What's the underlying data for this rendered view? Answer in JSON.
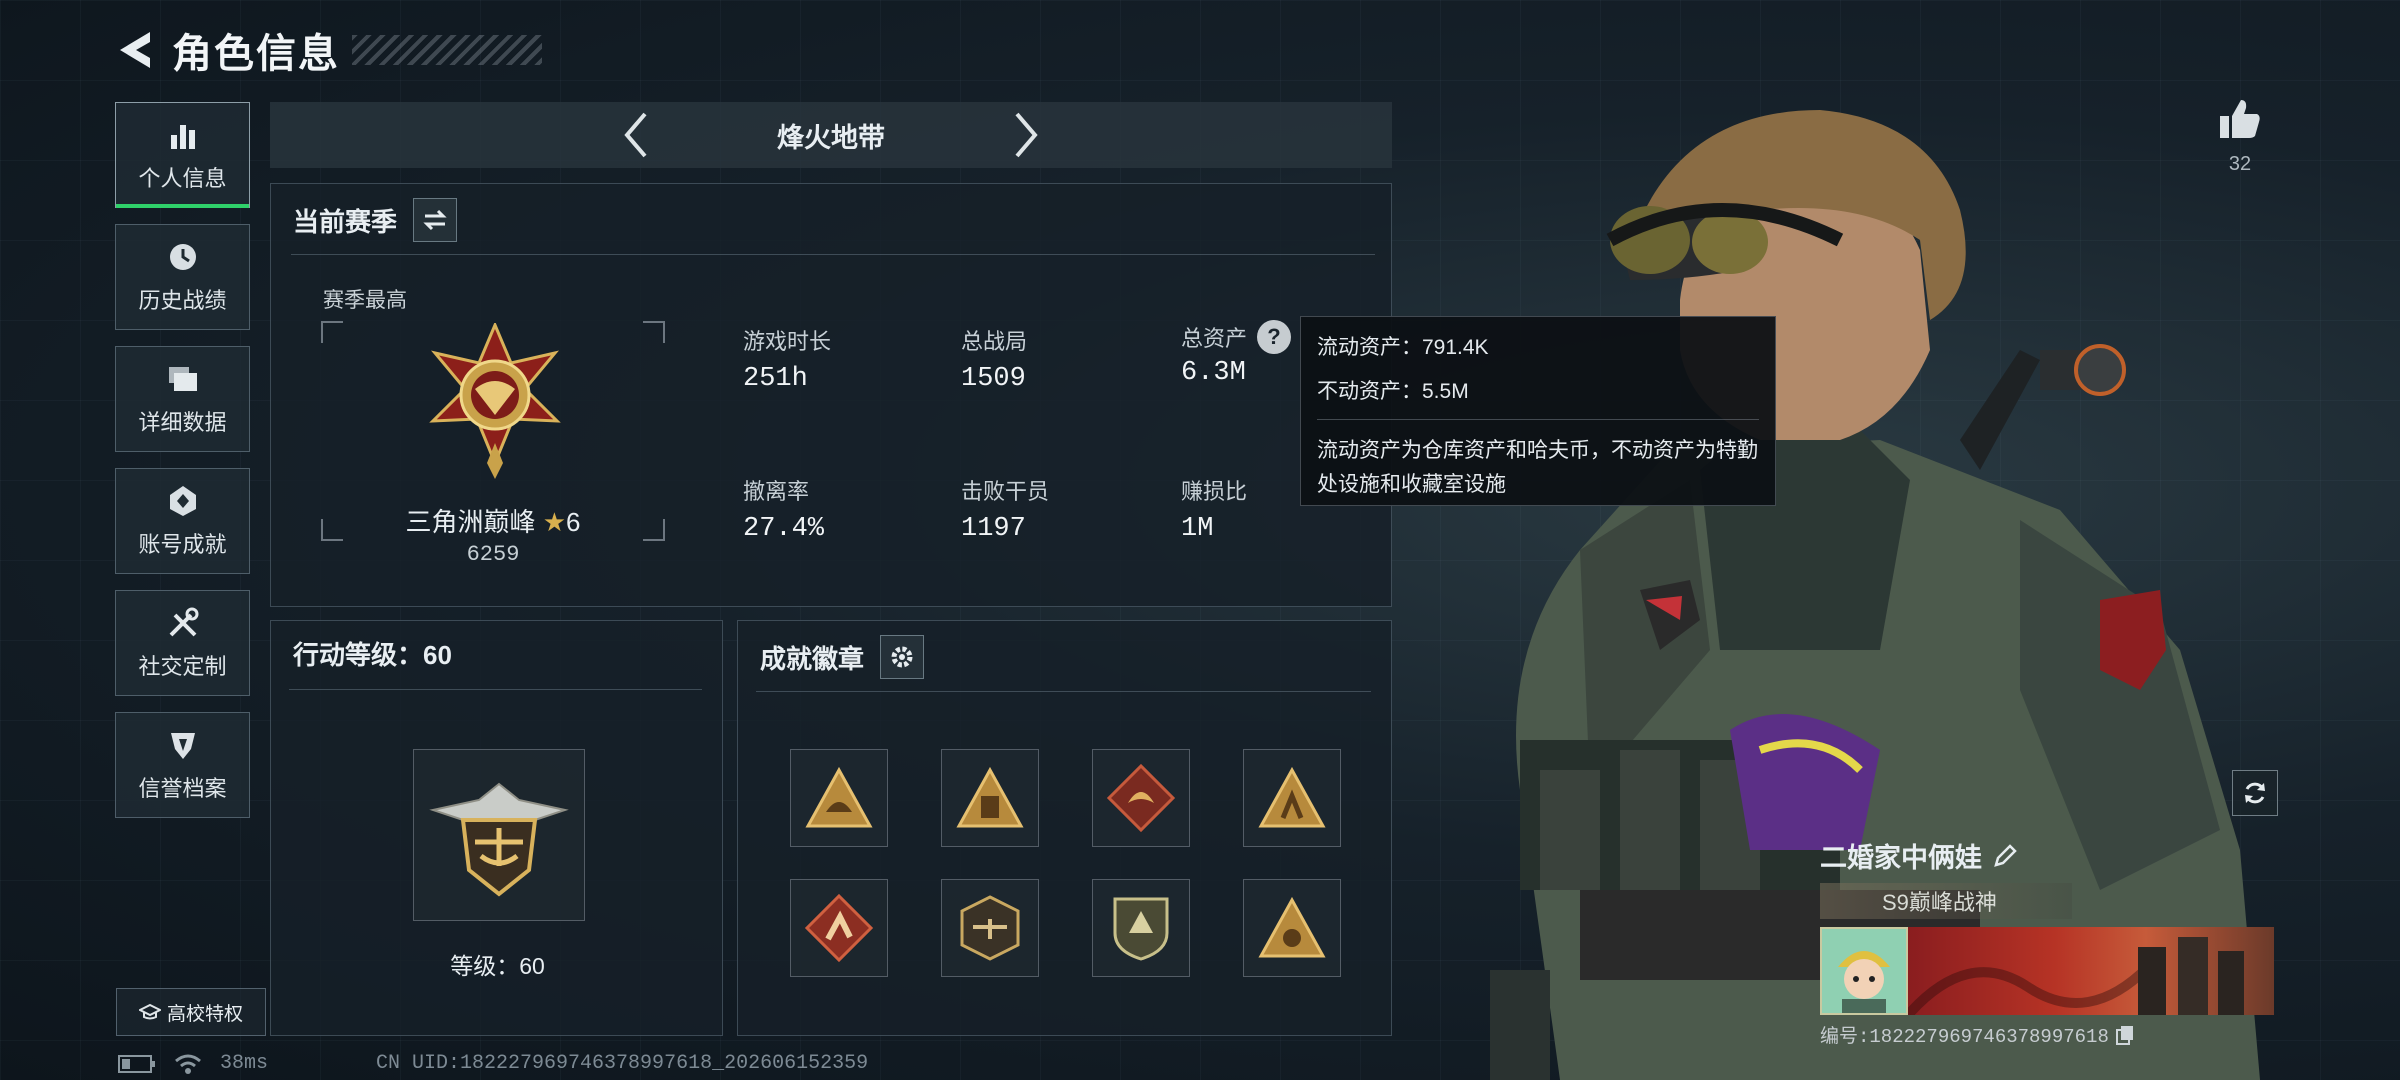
{
  "header": {
    "title": "角色信息"
  },
  "nav": {
    "items": [
      {
        "label": "个人信息",
        "active": true,
        "icon": "bar-chart-icon"
      },
      {
        "label": "历史战绩",
        "active": false,
        "icon": "clock-icon"
      },
      {
        "label": "详细数据",
        "active": false,
        "icon": "folder-icon"
      },
      {
        "label": "账号成就",
        "active": false,
        "icon": "achievement-icon"
      },
      {
        "label": "社交定制",
        "active": false,
        "icon": "tools-icon"
      },
      {
        "label": "信誉档案",
        "active": false,
        "icon": "shield-icon"
      }
    ],
    "campus_label": "高校特权"
  },
  "status": {
    "ping": "38ms",
    "uid": "CN UID:18222796974637899761​8_202606152359"
  },
  "mode": {
    "title": "烽火地带"
  },
  "season": {
    "title": "当前赛季",
    "highest_label": "赛季最高",
    "rank_name": "三角洲巅峰",
    "rank_stars": "6",
    "rank_score": "6259",
    "stats": [
      {
        "label": "游戏时长",
        "value": "251h"
      },
      {
        "label": "总战局",
        "value": "1509"
      },
      {
        "label": "总资产",
        "value": "6.3M"
      },
      {
        "label": "撤离率",
        "value": "27.4%"
      },
      {
        "label": "击败干员",
        "value": "1197"
      },
      {
        "label": "赚损比",
        "value": "1M"
      }
    ]
  },
  "tooltip": {
    "liquid": "流动资产：791.4K",
    "fixed": "不动资产：5.5M",
    "desc": "流动资产为仓库资产和哈夫币，不动资产为特勤处设施和收藏室设施"
  },
  "level": {
    "title": "行动等级：60",
    "level_label": "等级：60"
  },
  "badges": {
    "title": "成就徽章"
  },
  "likes": {
    "count": "32"
  },
  "profile": {
    "name": "二婚家中俩娃",
    "title_text": "S9巅峰战神",
    "id_text": "编号:18222796974637899761​8"
  }
}
